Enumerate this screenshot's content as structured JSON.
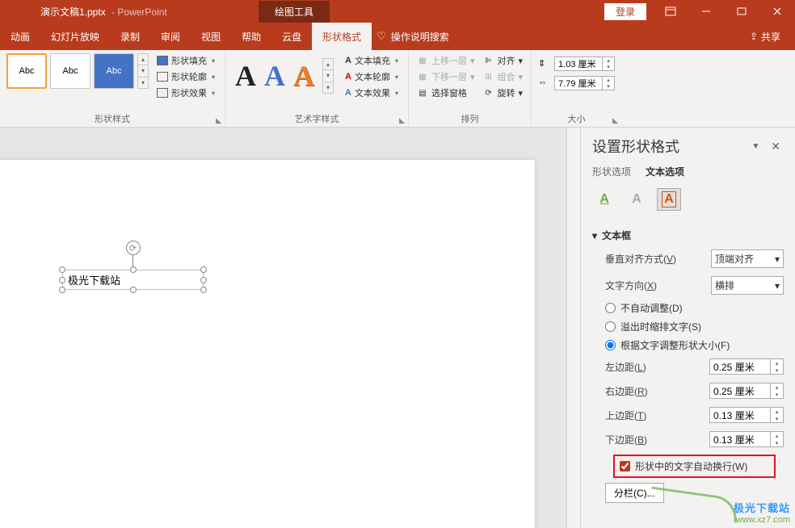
{
  "title": {
    "filename": "演示文稿1.pptx",
    "app": "PowerPoint",
    "context_tab": "绘图工具",
    "login": "登录"
  },
  "tabs": {
    "anim": "动画",
    "slideshow": "幻灯片放映",
    "record": "录制",
    "review": "审阅",
    "view": "视图",
    "help": "帮助",
    "cloud": "云盘",
    "shapefmt": "形状格式",
    "tellme": "操作说明搜索",
    "share": "共享"
  },
  "ribbon": {
    "style_thumb": "Abc",
    "shape_fill": "形状填充",
    "shape_outline": "形状轮廓",
    "shape_effects": "形状效果",
    "group_shape_styles": "形状样式",
    "text_fill": "文本填充",
    "text_outline": "文本轮廓",
    "text_effects": "文本效果",
    "group_wordart": "艺术字样式",
    "bring_fwd": "上移一层",
    "send_back": "下移一层",
    "selection_pane": "选择窗格",
    "align": "对齐",
    "group_objs": "组合",
    "rotate": "旋转",
    "group_arrange": "排列",
    "height": "1.03 厘米",
    "width": "7.79 厘米",
    "group_size": "大小"
  },
  "slide": {
    "shape_text": "极光下载站"
  },
  "pane": {
    "title": "设置形状格式",
    "tab_shape": "形状选项",
    "tab_text": "文本选项",
    "section_textbox": "文本框",
    "valign_label": "垂直对齐方式(V)",
    "valign_value": "顶端对齐",
    "textdir_label": "文字方向(X)",
    "textdir_value": "横排",
    "autofit_none": "不自动调整(D)",
    "autofit_shrink": "溢出时缩排文字(S)",
    "autofit_resize": "根据文字调整形状大小(F)",
    "margin_left_l": "左边距(L)",
    "margin_left_v": "0.25 厘米",
    "margin_right_l": "右边距(R)",
    "margin_right_v": "0.25 厘米",
    "margin_top_l": "上边距(T)",
    "margin_top_v": "0.13 厘米",
    "margin_bottom_l": "下边距(B)",
    "margin_bottom_v": "0.13 厘米",
    "wrap_text": "形状中的文字自动换行(W)",
    "columns": "分栏(C)..."
  },
  "watermark": {
    "l1": "极光下载站",
    "l2": "www.xz7.com"
  }
}
